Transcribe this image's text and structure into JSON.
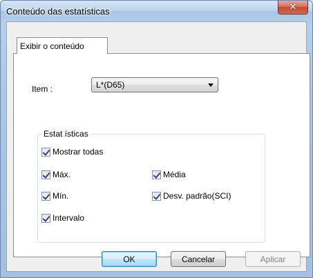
{
  "window": {
    "title": "Conteúdo das estatísticas",
    "close_glyph": "✕"
  },
  "tabs": [
    {
      "label": "Exibir o conteúdo",
      "active": true
    }
  ],
  "item": {
    "label": "Item :",
    "selected": "L*(D65)"
  },
  "statistics": {
    "group_label": "Estat ísticas",
    "show_all": {
      "label": "Mostrar todas",
      "checked": true
    },
    "options": [
      {
        "label": "Máx.",
        "checked": true
      },
      {
        "label": "Média",
        "checked": true
      },
      {
        "label": "Mín.",
        "checked": true
      },
      {
        "label": "Desv. padrão(SCI)",
        "checked": true
      },
      {
        "label": "Intervalo",
        "checked": true
      }
    ]
  },
  "buttons": {
    "ok": "OK",
    "cancel": "Cancelar",
    "apply": "Aplicar"
  },
  "colors": {
    "close_button": "#c24a33",
    "default_button_border": "#3c7fb1",
    "checkmark": "#3a3e86"
  },
  "icons": [
    "close-icon",
    "dropdown-arrow-icon",
    "checkmark-icon"
  ]
}
